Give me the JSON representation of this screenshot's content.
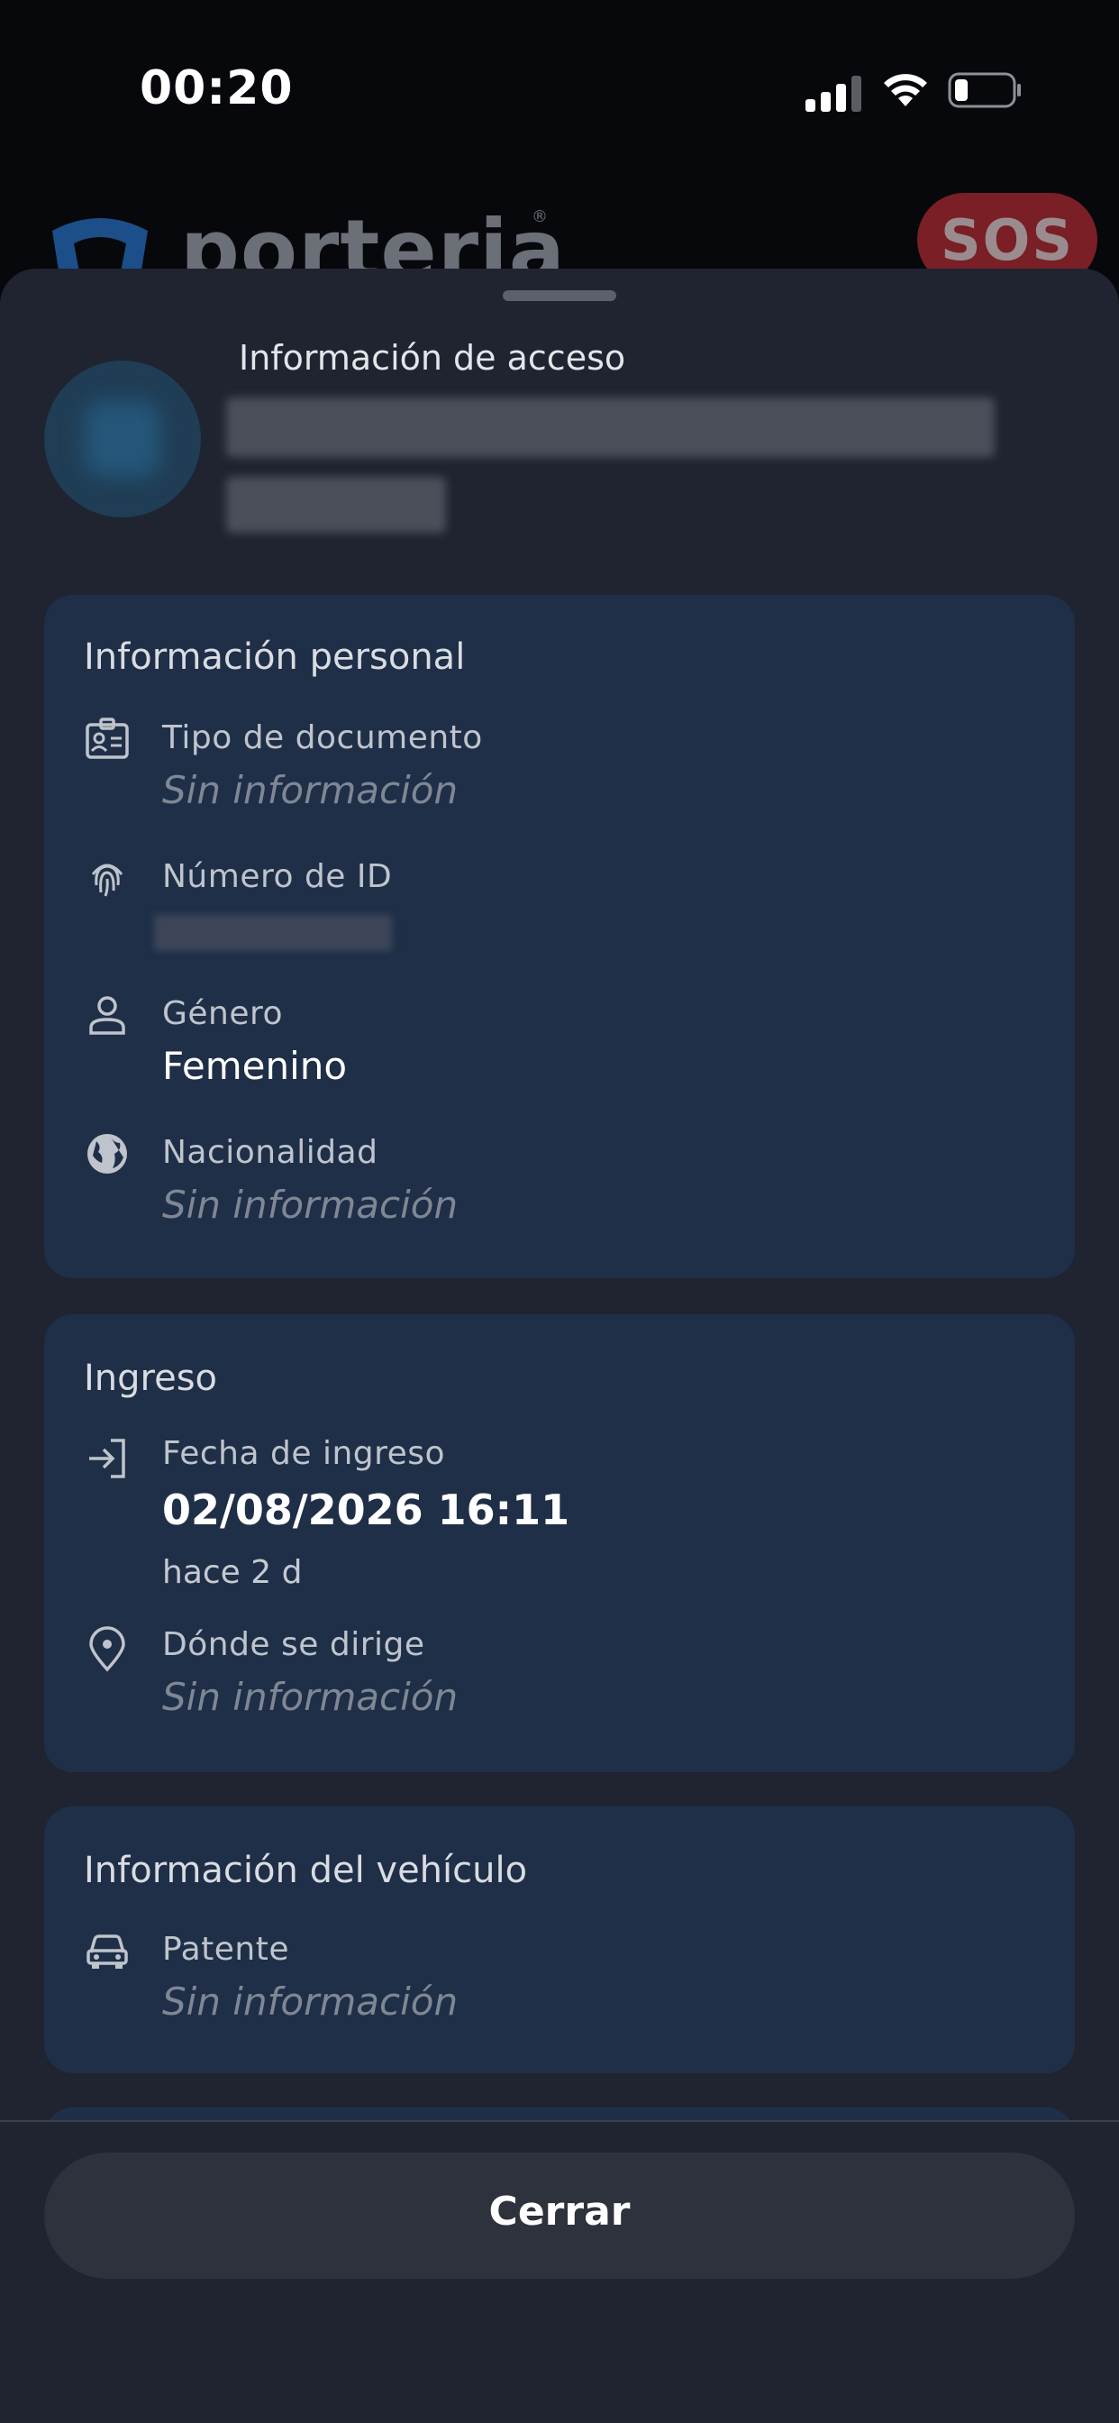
{
  "status_bar": {
    "time": "00:20"
  },
  "background_app": {
    "logo_text": "porteria",
    "logo_reg": "®",
    "sos_label": "SOS"
  },
  "sheet": {
    "title": "Información de acceso"
  },
  "personal": {
    "title": "Información personal",
    "document_type": {
      "label": "Tipo de documento",
      "value": "Sin información",
      "icon": "id-card-icon"
    },
    "id_number": {
      "label": "Número de ID",
      "icon": "fingerprint-icon"
    },
    "gender": {
      "label": "Género",
      "value": "Femenino",
      "icon": "person-icon"
    },
    "nationality": {
      "label": "Nacionalidad",
      "value": "Sin información",
      "icon": "globe-icon"
    }
  },
  "entry": {
    "title": "Ingreso",
    "date": {
      "label": "Fecha de ingreso",
      "value": "02/08/2026 16:11",
      "relative": "hace 2 d",
      "icon": "login-arrow-icon"
    },
    "destination": {
      "label": "Dónde se dirige",
      "value": "Sin información",
      "icon": "location-pin-icon"
    }
  },
  "vehicle": {
    "title": "Información del vehículo",
    "plate": {
      "label": "Patente",
      "value": "Sin información",
      "icon": "car-icon"
    }
  },
  "footer": {
    "close_label": "Cerrar"
  },
  "colors": {
    "sheet_bg": "#1f2430",
    "card_bg": "#1f2f48",
    "sos_red": "#7a1f25",
    "logo_blue": "#1c4f8a"
  }
}
